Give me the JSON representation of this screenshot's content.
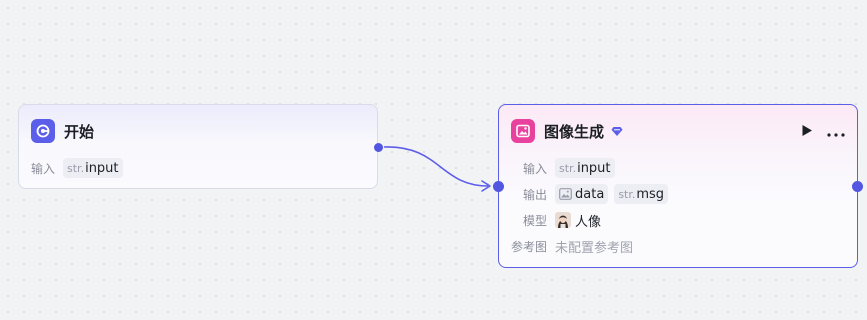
{
  "colors": {
    "accent": "#5b5ee8",
    "gen_icon": "#e8419e",
    "canvas": "#f2f3f5"
  },
  "start_node": {
    "title": "开始",
    "icon": "start-icon",
    "inputs_label": "输入",
    "inputs": [
      {
        "type": "str.",
        "name": "input"
      }
    ]
  },
  "image_gen_node": {
    "title": "图像生成",
    "icon": "image-gen-icon",
    "badge_icon": "diamond-icon",
    "actions": {
      "run_icon": "play-icon",
      "more_icon": "more-icon"
    },
    "inputs_label": "输入",
    "inputs": [
      {
        "type": "str.",
        "name": "input"
      }
    ],
    "outputs_label": "输出",
    "outputs": [
      {
        "type_icon": "image-icon",
        "name": "data"
      },
      {
        "type": "str.",
        "name": "msg"
      }
    ],
    "model_label": "模型",
    "model": {
      "avatar": "avatar",
      "name": "人像"
    },
    "reference_label": "参考图",
    "reference_value": "未配置参考图"
  }
}
